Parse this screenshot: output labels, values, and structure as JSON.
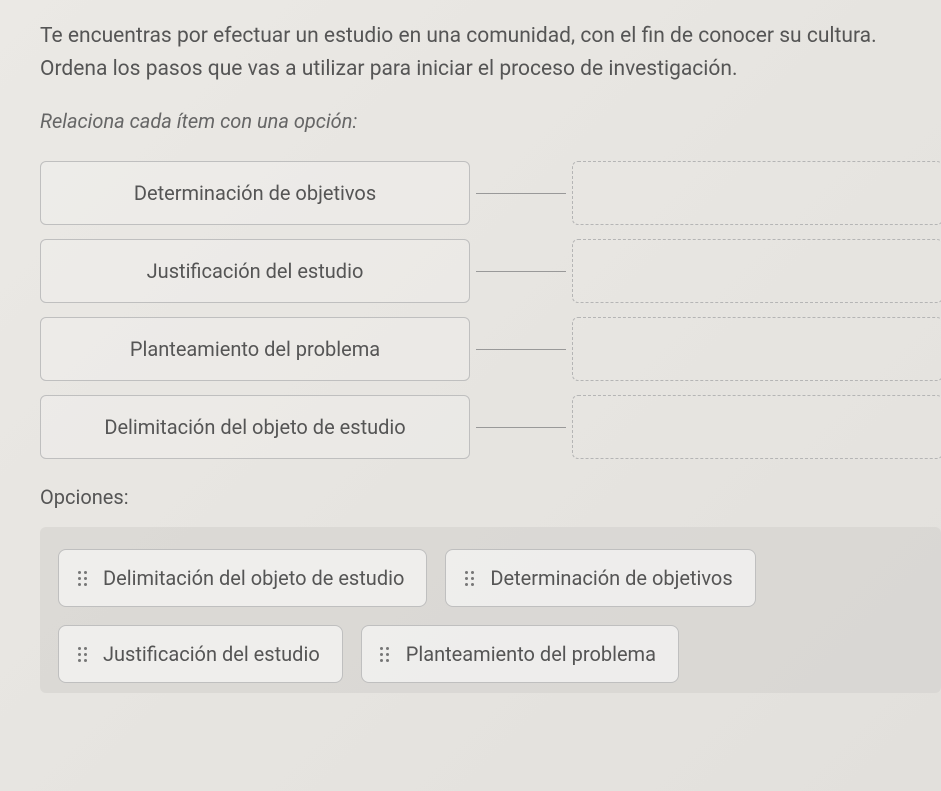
{
  "question": "Te encuentras por efectuar un estudio en una comunidad, con el fin de conocer su cultura. Ordena los pasos que vas a utilizar para iniciar el proceso de investigación.",
  "instruction": "Relaciona cada ítem con una opción:",
  "items": [
    {
      "label": "Determinación de objetivos"
    },
    {
      "label": "Justificación del estudio"
    },
    {
      "label": "Planteamiento del problema"
    },
    {
      "label": "Delimitación del objeto de estudio"
    }
  ],
  "options_label": "Opciones:",
  "options": [
    {
      "label": "Delimitación del objeto de estudio"
    },
    {
      "label": "Determinación de objetivos"
    },
    {
      "label": "Justificación del estudio"
    },
    {
      "label": "Planteamiento del problema"
    }
  ]
}
